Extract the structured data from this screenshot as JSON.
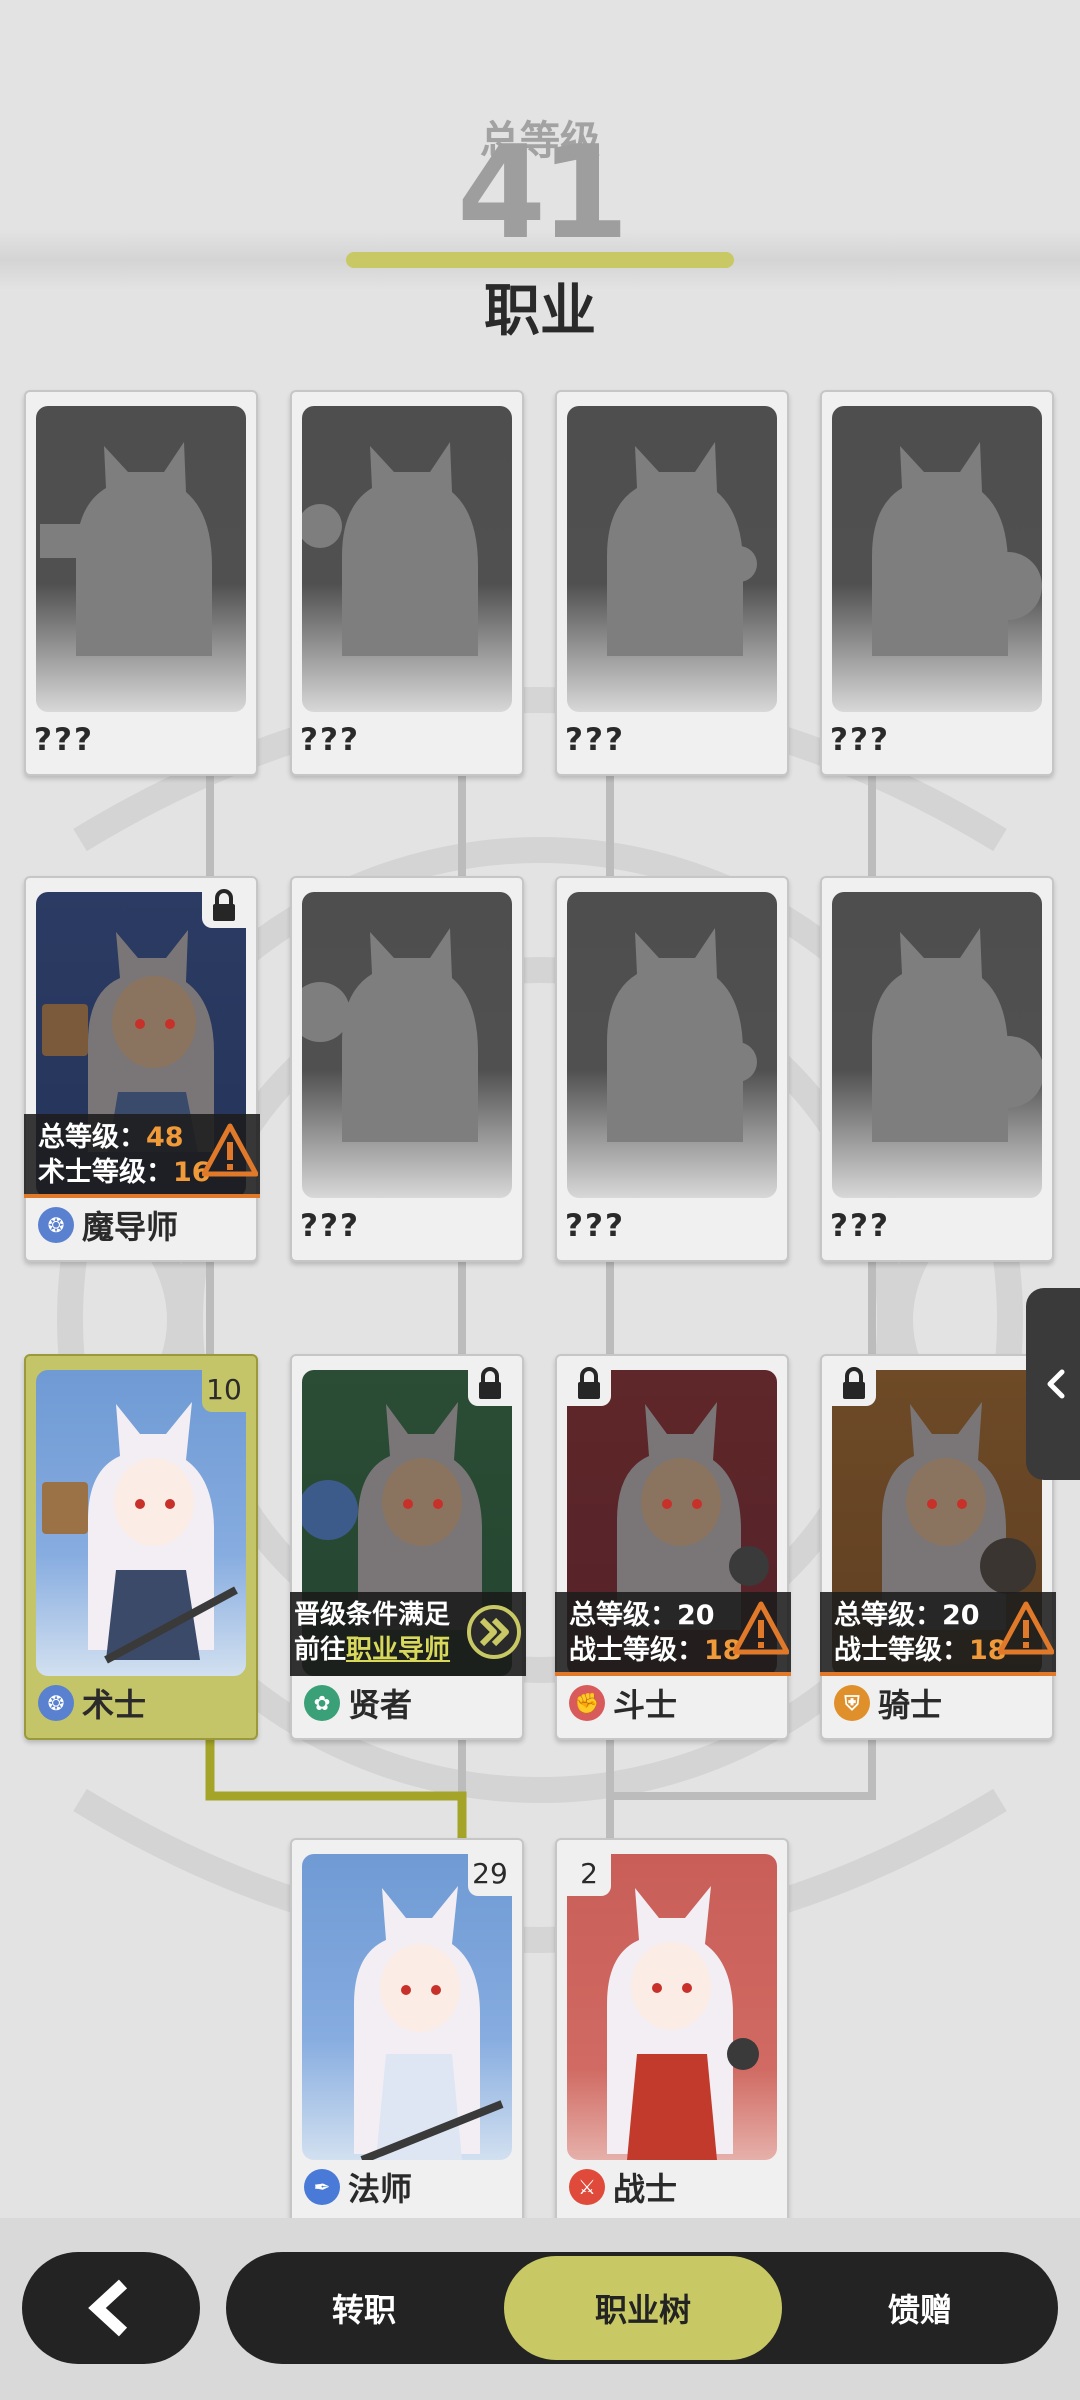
{
  "header": {
    "level_label": "总等级",
    "level_value": "41",
    "title": "职业"
  },
  "unknown_name": "???",
  "jobs": {
    "mage_master": {
      "name": "魔导师",
      "req_total_label": "总等级：",
      "req_total_value": "48",
      "req_class_label": "术士等级：",
      "req_class_value": "16"
    },
    "warlock": {
      "name": "术士",
      "level": "10"
    },
    "sage": {
      "name": "贤者",
      "hint_line1": "晋级条件满足",
      "hint_line2_prefix": "前往",
      "hint_line2_link": "职业导师"
    },
    "fighter": {
      "name": "斗士",
      "req_total_label": "总等级：",
      "req_total_value": "20",
      "req_class_label": "战士等级：",
      "req_class_value": "18"
    },
    "knight": {
      "name": "骑士",
      "req_total_label": "总等级：",
      "req_total_value": "20",
      "req_class_label": "战士等级：",
      "req_class_value": "18"
    },
    "mage": {
      "name": "法师",
      "level": "29"
    },
    "warrior": {
      "name": "战士",
      "level": "2"
    }
  },
  "tabs": {
    "transfer": "转职",
    "job_tree": "职业树",
    "gift": "馈赠"
  },
  "icons": {
    "back": "back-arrow-icon",
    "side": "chevron-left-icon",
    "lock": "lock-icon",
    "warning": "warning-icon",
    "go": "double-chevron-icon"
  },
  "colors": {
    "accent": "#c8c864",
    "dark": "#232323",
    "warning": "#e07a2a",
    "tree_active": "#a4a428"
  }
}
